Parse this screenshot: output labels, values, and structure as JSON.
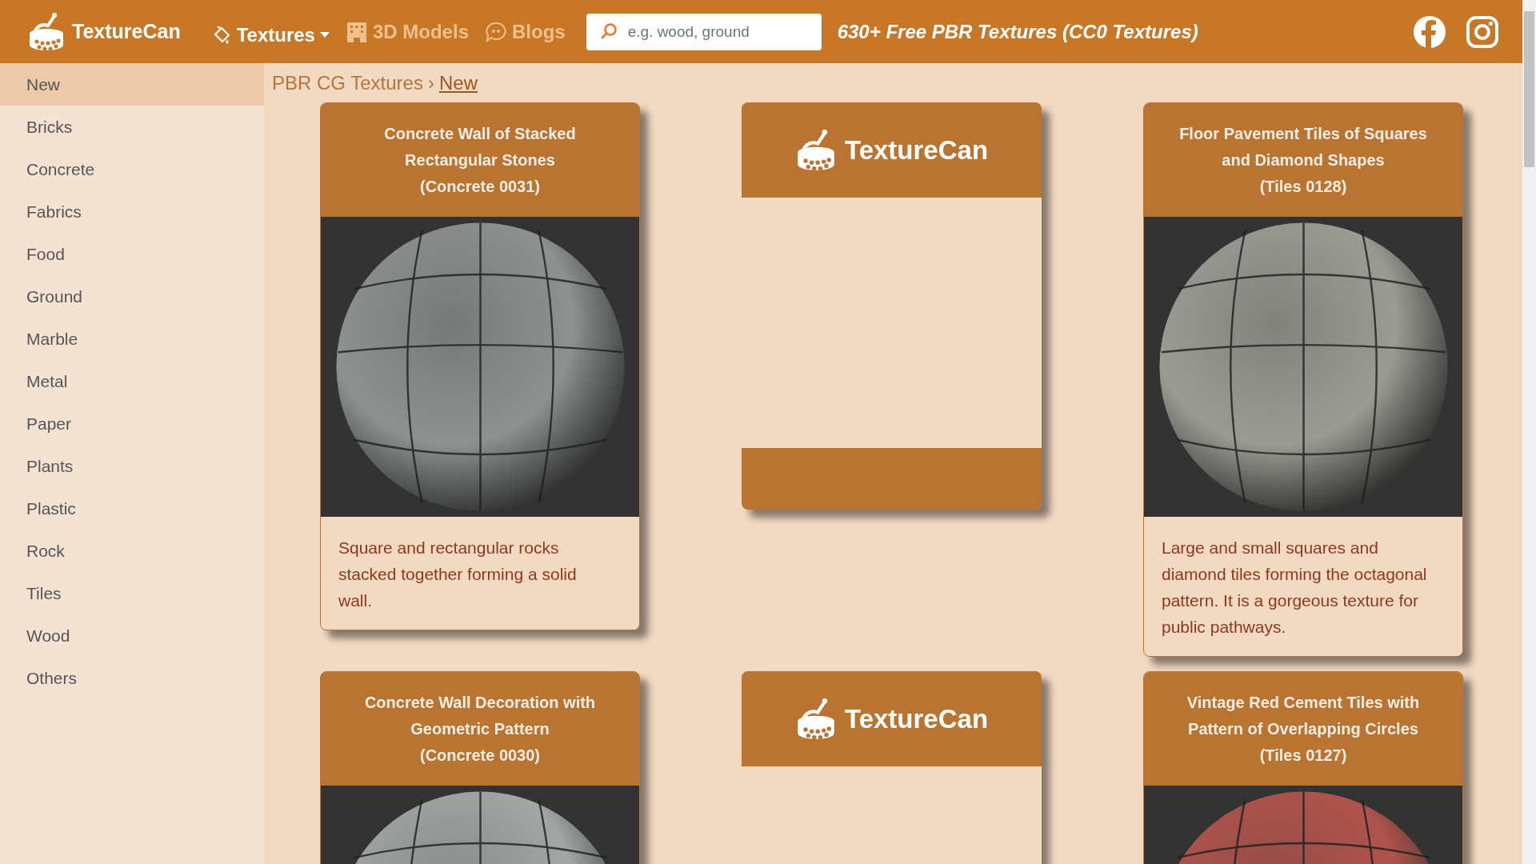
{
  "header": {
    "logo_text": "TextureCan",
    "nav": [
      {
        "label": "Textures",
        "kind": "dropdown"
      },
      {
        "label": "3D Models",
        "kind": "building"
      },
      {
        "label": "Blogs",
        "kind": "chat"
      }
    ],
    "search": {
      "placeholder": "e.g. wood, ground"
    },
    "tagline": "630+ Free PBR Textures (CC0 Textures)"
  },
  "sidebar": {
    "items": [
      {
        "label": "New",
        "selected": true
      },
      {
        "label": "Bricks",
        "selected": false
      },
      {
        "label": "Concrete",
        "selected": false
      },
      {
        "label": "Fabrics",
        "selected": false
      },
      {
        "label": "Food",
        "selected": false
      },
      {
        "label": "Ground",
        "selected": false
      },
      {
        "label": "Marble",
        "selected": false
      },
      {
        "label": "Metal",
        "selected": false
      },
      {
        "label": "Paper",
        "selected": false
      },
      {
        "label": "Plants",
        "selected": false
      },
      {
        "label": "Plastic",
        "selected": false
      },
      {
        "label": "Rock",
        "selected": false
      },
      {
        "label": "Tiles",
        "selected": false
      },
      {
        "label": "Wood",
        "selected": false
      },
      {
        "label": "Others",
        "selected": false
      }
    ]
  },
  "breadcrumb": {
    "parent": "PBR CG Textures",
    "separator": "›",
    "current": "New"
  },
  "cards": [
    {
      "kind": "texture",
      "title": "Concrete Wall of Stacked Rectangular Stones",
      "code": "(Concrete 0031)",
      "color": "#8e9190",
      "description": "Square and rectangular rocks stacked together forming a solid wall."
    },
    {
      "kind": "ad",
      "logo_text": "TextureCan"
    },
    {
      "kind": "texture",
      "title": "Floor Pavement Tiles of Squares and Diamond Shapes",
      "code": "(Tiles 0128)",
      "color": "#9a9c94",
      "description": "Large and small squares and diamond tiles forming the octagonal pattern. It is a gorgeous texture for public pathways."
    },
    {
      "kind": "texture",
      "title": "Concrete Wall Decoration with Geometric Pattern",
      "code": "(Concrete 0030)",
      "color": "#a4a6a6"
    },
    {
      "kind": "ad",
      "logo_text": "TextureCan"
    },
    {
      "kind": "texture",
      "title": "Vintage Red Cement Tiles with Pattern of Overlapping Circles",
      "code": "(Tiles 0127)",
      "color": "#b0544c"
    }
  ]
}
